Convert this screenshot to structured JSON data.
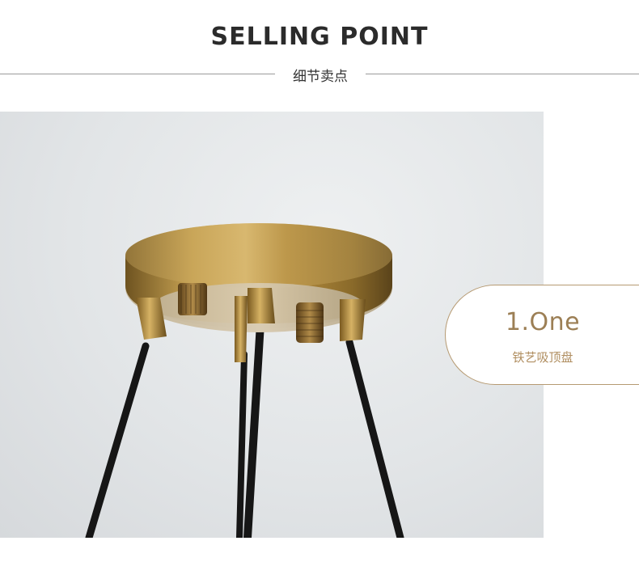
{
  "header": {
    "title": "SELLING POINT",
    "subtitle": "细节卖点"
  },
  "photo": {
    "alt": "brass ceiling canopy with black rods"
  },
  "info_card": {
    "title": "1.One",
    "subtitle": "铁艺吸顶盘"
  },
  "colors": {
    "accent_gold": "#9c7f55",
    "brass": "#b8913e",
    "rod": "#1a1a1a"
  }
}
